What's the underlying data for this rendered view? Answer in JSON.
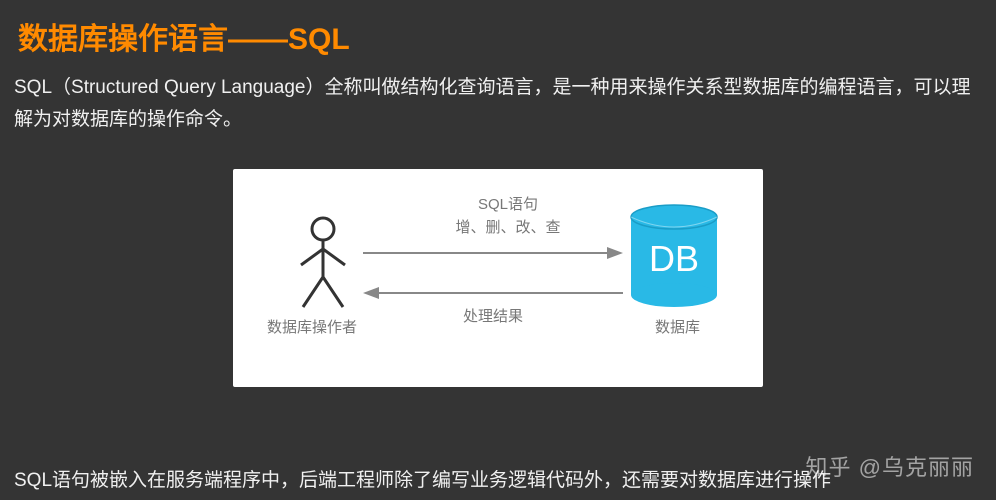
{
  "title": "数据库操作语言——SQL",
  "desc": "SQL（Structured Query Language）全称叫做结构化查询语言，是一种用来操作关系型数据库的编程语言，可以理解为对数据库的操作命令。",
  "diagram": {
    "operator_label": "数据库操作者",
    "sql_line1": "SQL语句",
    "sql_line2": "增、删、改、查",
    "result_label": "处理结果",
    "db_text": "DB",
    "db_label": "数据库"
  },
  "bottom_text": "SQL语句被嵌入在服务端程序中，后端工程师除了编写业务逻辑代码外，还需要对数据库进行操作",
  "watermark": "知乎 @乌克丽丽",
  "colors": {
    "accent": "#ff8a00",
    "db_blue": "#29b9e6"
  }
}
